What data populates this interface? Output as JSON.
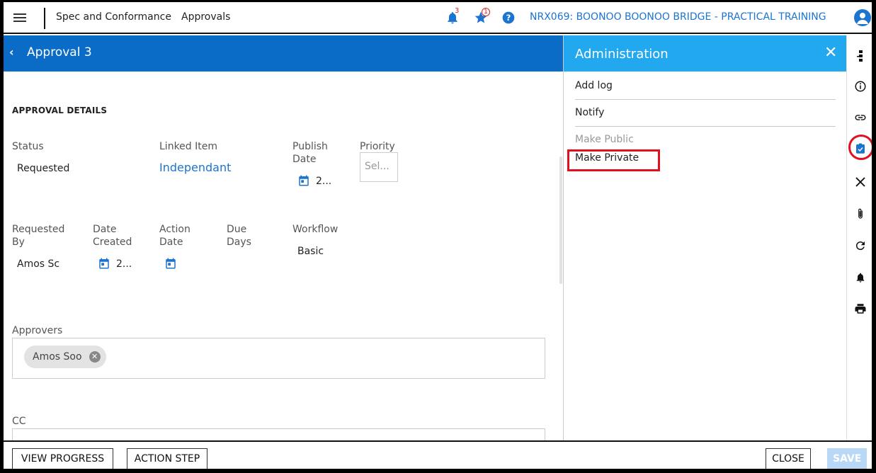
{
  "header": {
    "module": "Spec and Conformance",
    "page": "Approvals",
    "notification_count": "3",
    "favorites_count": "1",
    "project": "NRX069: BOONOO BOONOO BRIDGE - PRACTICAL TRAINING"
  },
  "titlebar": {
    "back": "‹",
    "title": "Approval 3"
  },
  "form": {
    "section_title": "APPROVAL DETAILS",
    "status": {
      "label": "Status",
      "value": "Requested"
    },
    "linked_item": {
      "label": "Linked Item",
      "value": "Independant"
    },
    "publish_date": {
      "label_1": "Publish",
      "label_2": "Date",
      "value": "2..."
    },
    "priority": {
      "label": "Priority",
      "placeholder": "Sel..."
    },
    "requested_by": {
      "label_1": "Requested",
      "label_2": "By",
      "value": "Amos Sc"
    },
    "date_created": {
      "label_1": "Date",
      "label_2": "Created",
      "value": "2..."
    },
    "action_date": {
      "label_1": "Action",
      "label_2": "Date"
    },
    "due_days": {
      "label_1": "Due",
      "label_2": "Days"
    },
    "workflow": {
      "label": "Workflow",
      "value": "Basic"
    },
    "approvers": {
      "label": "Approvers",
      "chips": [
        "Amos Soo"
      ]
    },
    "cc": {
      "label": "CC"
    }
  },
  "admin": {
    "title": "Administration",
    "close": "✕",
    "items": [
      {
        "label": "Add log",
        "enabled": true
      },
      {
        "label": "Notify",
        "enabled": true
      },
      {
        "label": "Make Public",
        "enabled": false
      },
      {
        "label": "Make Private",
        "enabled": true
      }
    ]
  },
  "rail": {
    "icons": [
      "workflow-icon",
      "info-icon",
      "link-icon",
      "approval-icon",
      "close-icon",
      "attachment-icon",
      "refresh-icon",
      "bell-icon",
      "print-icon"
    ]
  },
  "footer": {
    "view_progress": "VIEW PROGRESS",
    "action_step": "ACTION STEP",
    "close": "CLOSE",
    "save": "SAVE"
  },
  "colors": {
    "primary": "#0b6cc7",
    "admin_header": "#21a8ee",
    "link": "#1b74d0",
    "highlight": "#e0101e"
  }
}
